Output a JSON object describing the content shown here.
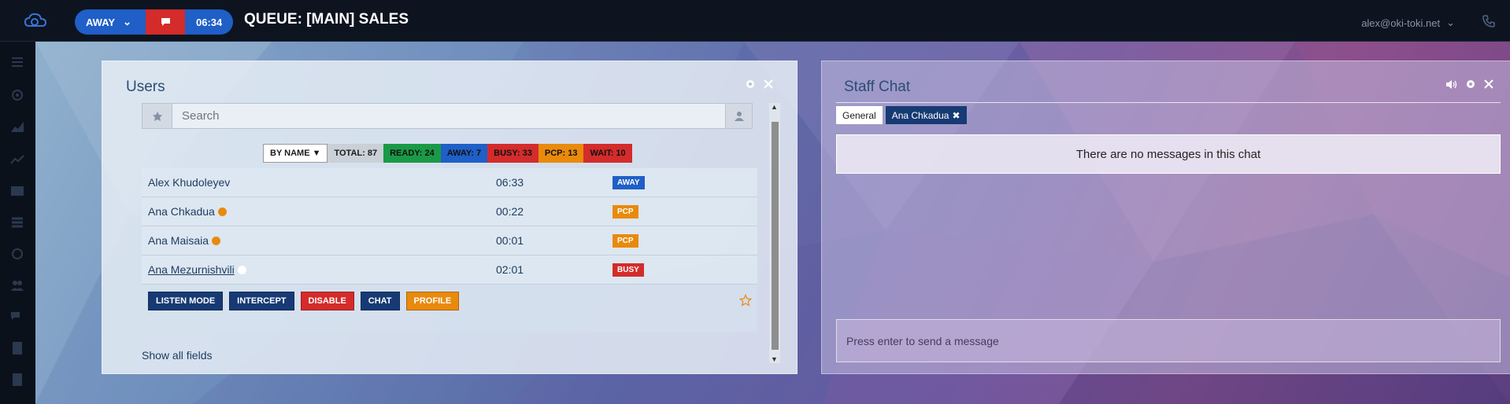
{
  "header": {
    "status_label": "AWAY",
    "timer": "06:34",
    "queue_title": "QUEUE: [MAIN] SALES",
    "user_email": "alex@oki-toki.net"
  },
  "sidebar": {
    "icons": [
      "menu-icon",
      "settings-icon",
      "area-chart-icon",
      "line-chart-icon",
      "contact-card-icon",
      "list-icon",
      "circle-icon",
      "users-icon",
      "chats-icon",
      "phone-book-icon",
      "address-book-icon"
    ]
  },
  "users_panel": {
    "title": "Users",
    "search_placeholder": "Search",
    "filters": {
      "sort": "BY NAME ▼",
      "total": "TOTAL: 87",
      "ready": "READY: 24",
      "away": "AWAY: 7",
      "busy": "BUSY: 33",
      "pcp": "PCP: 13",
      "wait": "WAIT: 10"
    },
    "users": [
      {
        "name": "Alex Khudoleyev",
        "time": "06:33",
        "status": "AWAY",
        "presence": "none"
      },
      {
        "name": "Ana Chkadua",
        "time": "00:22",
        "status": "PCP",
        "presence": "orange"
      },
      {
        "name": "Ana Maisaia",
        "time": "00:01",
        "status": "PCP",
        "presence": "orange"
      },
      {
        "name": "Ana Mezurnishvili",
        "time": "02:01",
        "status": "BUSY",
        "presence": "white"
      }
    ],
    "actions": {
      "listen": "LISTEN MODE",
      "intercept": "INTERCEPT",
      "disable": "DISABLE",
      "chat": "CHAT",
      "profile": "PROFILE"
    },
    "show_all": "Show all fields"
  },
  "staff_chat": {
    "title": "Staff Chat",
    "tabs": [
      "General",
      "Ana Chkadua"
    ],
    "empty_message": "There are no messages in this chat",
    "input_placeholder": "Press enter to send a message"
  },
  "colors": {
    "away": "#1f5fc7",
    "busy": "#d42b2b",
    "pcp": "#e98a0c",
    "ready": "#1a9a46",
    "navy": "#173a74"
  }
}
